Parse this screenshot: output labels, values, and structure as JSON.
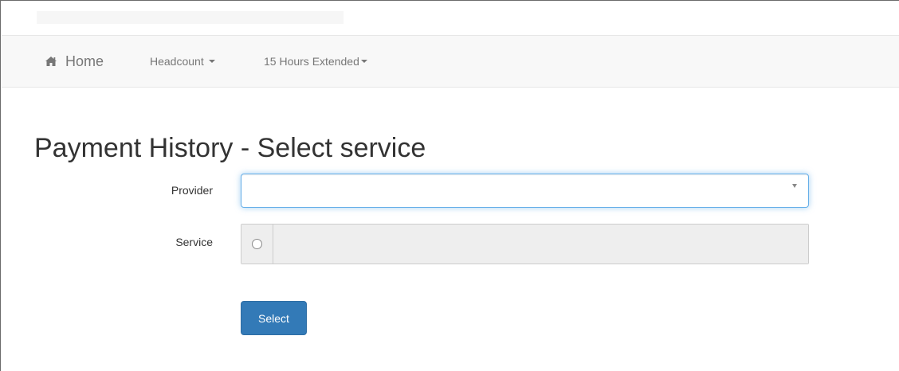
{
  "navbar": {
    "brand_label": "Home",
    "brand_icon": "home-icon",
    "items": [
      {
        "label": "Headcount"
      },
      {
        "label": "15 Hours Extended"
      }
    ]
  },
  "page": {
    "title": "Payment History - Select service"
  },
  "form": {
    "provider_label": "Provider",
    "provider_value": "",
    "service_label": "Service",
    "service_value": "",
    "submit_label": "Select"
  },
  "colors": {
    "navbar_bg": "#f8f8f8",
    "primary": "#337ab7",
    "focus_border": "#66afe9",
    "disabled_bg": "#eeeeee"
  }
}
